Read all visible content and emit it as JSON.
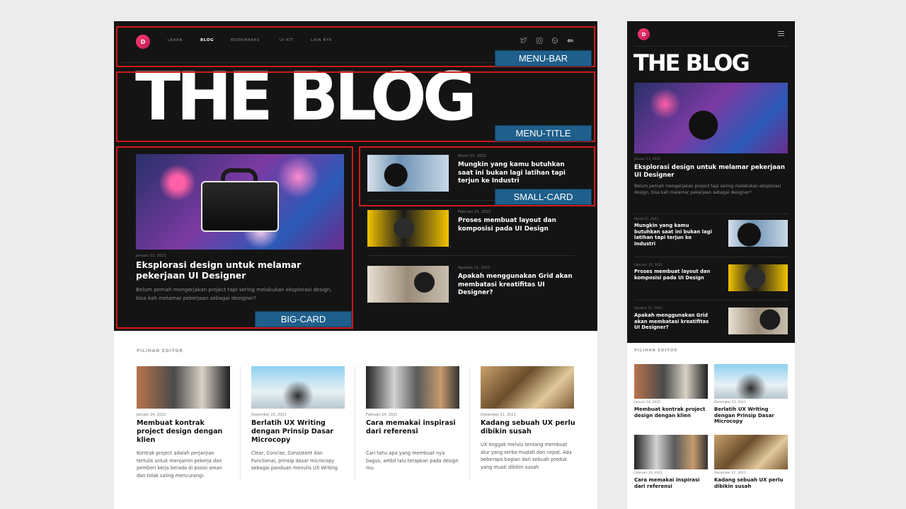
{
  "brand": {
    "logo_letter": "D"
  },
  "nav": {
    "items": [
      {
        "label": "LEARN",
        "active": false
      },
      {
        "label": "BLOG",
        "active": true
      },
      {
        "label": "BOOKMARKS",
        "active": false
      },
      {
        "label": "UI KIT",
        "active": false
      },
      {
        "label": "LAIN NYA",
        "active": false
      }
    ],
    "social_icons": [
      "twitter-icon",
      "instagram-icon",
      "dribbble-icon",
      "medium-icon"
    ]
  },
  "hero": {
    "title": "THE BLOG"
  },
  "big_card": {
    "date": "Januari 11, 2022",
    "title": "Eksplorasi design untuk melamar pekerjaan UI Designer",
    "desc": "Belum pernah mengerjakan project tapi sering melakukan eksplorasi design, bisa kah melamar pekerjaan sebagai designer?",
    "mobile_desc": "Belum pernah mengerjakan project tapi sering melakukan eksplorasi design, bisa kah melamar pekerjaan sebagai designer?"
  },
  "small_cards": [
    {
      "date": "Maret 07, 2022",
      "title": "Mungkin yang kamu butuhkan saat ini bukan lagi latihan tapi terjun ke Industri"
    },
    {
      "date": "Februari 15, 2022",
      "title": "Proses membuat layout dan komposisi pada UI Design"
    },
    {
      "date": "Agustus 11, 2021",
      "title": "Apakah menggunakan Grid akan membatasi kreatifitas UI Designer?"
    }
  ],
  "editor": {
    "label": "PILIHAN EDITOR",
    "items": [
      {
        "date": "Januari 24, 2022",
        "title": "Membuat kontrak project design dengan klien",
        "desc": "Kontrak project adalah perjanjian tertulis untuk menjamin pekerja dan pemberi kerja berada di posisi aman dan tidak saling mencurangi."
      },
      {
        "date": "Desember 23, 2021",
        "title": "Berlatih UX Writing dengan Prinsip Dasar Microcopy",
        "desc": "Clear, Concise, Consistent dan Functional, prinsip dasar microcopy sebagai panduan menulis UX Writing"
      },
      {
        "date": "Februari 24, 2021",
        "title": "Cara memakai inspirasi dari referensi",
        "desc": "Cari tahu apa yang membuat nya bagus, ambil lalu terapkan pada design mu."
      },
      {
        "date": "Desember 21, 2021",
        "title": "Kadang sebuah UX perlu dibikin susah",
        "desc": "UX enggak melulu tentang membuat alur yang serba mudah dan cepat. Ada beberapa bagian dari sebuah produk yang musti dibikin susah"
      }
    ]
  },
  "annotations": {
    "menu_bar": "MENU-BAR",
    "menu_title": "MENU-TITLE",
    "small_card": "SMALL-CARD",
    "big_card": "BIG-CARD"
  },
  "colors": {
    "dark_bg": "#141414",
    "annotation_red": "#d0191c",
    "annotation_blue": "#1f5f8b",
    "logo_pink": "#e91e63"
  }
}
